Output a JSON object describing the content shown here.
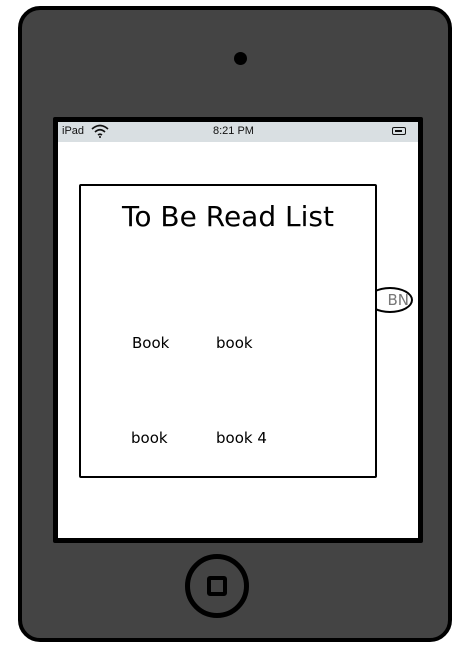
{
  "statusbar": {
    "carrier": "iPad",
    "time": "8:21 PM",
    "wifi_icon": "wifi-icon",
    "battery_icon": "battery-icon"
  },
  "bn_button": {
    "label": "BN"
  },
  "panel": {
    "title": "To Be Read List",
    "books": [
      "Book",
      "book",
      "book",
      "book 4"
    ]
  },
  "icons": {
    "camera": "camera-icon",
    "home": "home-button-icon"
  },
  "colors": {
    "device_body": "#444444",
    "statusbar_bg": "#d9dfe2",
    "screen_bg": "#ffffff"
  }
}
